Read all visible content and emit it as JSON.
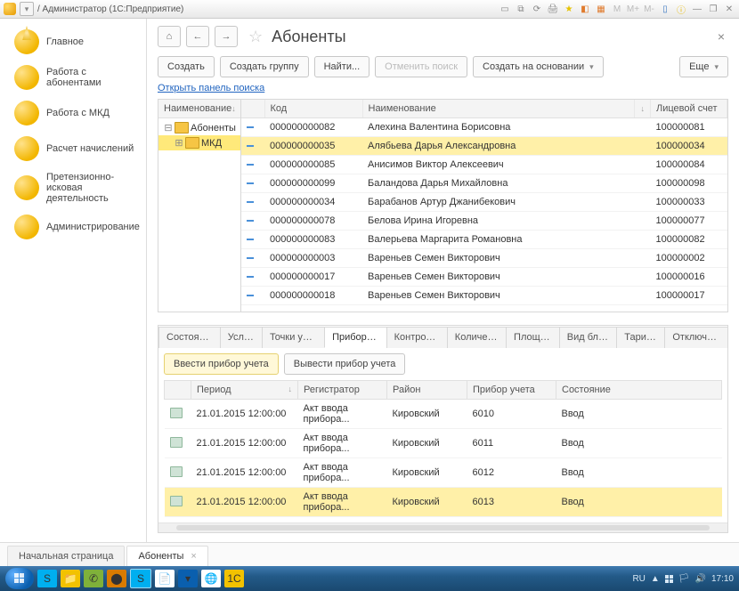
{
  "titlebar": {
    "text": "/ Администратор  (1С:Предприятие)"
  },
  "sidebar": {
    "items": [
      {
        "label": "Главное"
      },
      {
        "label": "Работа с абонентами"
      },
      {
        "label": "Работа с МКД"
      },
      {
        "label": "Расчет начислений"
      },
      {
        "label": "Претензионно-исковая деятельность"
      },
      {
        "label": "Администрирование"
      }
    ]
  },
  "page": {
    "title": "Абоненты"
  },
  "toolbar": {
    "create": "Создать",
    "create_group": "Создать группу",
    "find": "Найти...",
    "cancel_find": "Отменить поиск",
    "create_based": "Создать на основании",
    "more": "Еще"
  },
  "search_link": "Открыть панель поиска",
  "tree": {
    "header": "Наименование",
    "items": [
      {
        "label": "Абоненты",
        "selected": false,
        "expander": "⊟"
      },
      {
        "label": "МКД",
        "selected": true,
        "expander": "⊞"
      }
    ]
  },
  "grid": {
    "columns": {
      "code": "Код",
      "name": "Наименование",
      "account": "Лицевой счет"
    },
    "rows": [
      {
        "code": "000000000082",
        "name": "Алехина Валентина Борисовна",
        "account": "100000081"
      },
      {
        "code": "000000000035",
        "name": "Алябьева Дарья Александровна",
        "account": "100000034",
        "selected": true
      },
      {
        "code": "000000000085",
        "name": "Анисимов Виктор Алексеевич",
        "account": "100000084"
      },
      {
        "code": "000000000099",
        "name": "Баландова Дарья Михайловна",
        "account": "100000098"
      },
      {
        "code": "000000000034",
        "name": "Барабанов Артур Джанибекович",
        "account": "100000033"
      },
      {
        "code": "000000000078",
        "name": "Белова Ирина Игоревна",
        "account": "100000077"
      },
      {
        "code": "000000000083",
        "name": "Валерьева Маргарита Романовна",
        "account": "100000082"
      },
      {
        "code": "000000000003",
        "name": "Вареньев Семен Викторович",
        "account": "100000002"
      },
      {
        "code": "000000000017",
        "name": "Вареньев Семен Викторович",
        "account": "100000016"
      },
      {
        "code": "000000000018",
        "name": "Вареньев Семен Викторович",
        "account": "100000017"
      }
    ]
  },
  "tabs": [
    "Состояни...",
    "Услуги",
    "Точки учета",
    "Приборы ...",
    "Контроле...",
    "Количест...",
    "Площадь",
    "Вид благ...",
    "Тарифы",
    "Отключае..."
  ],
  "tabs_active_index": 3,
  "detail_toolbar": {
    "enter_meter": "Ввести прибор учета",
    "remove_meter": "Вывести прибор учета"
  },
  "detail_grid": {
    "columns": {
      "period": "Период",
      "registrar": "Регистратор",
      "district": "Район",
      "meter": "Прибор учета",
      "state": "Состояние"
    },
    "rows": [
      {
        "period": "21.01.2015 12:00:00",
        "registrar": "Акт ввода прибора...",
        "district": "Кировский",
        "meter": "6010",
        "state": "Ввод"
      },
      {
        "period": "21.01.2015 12:00:00",
        "registrar": "Акт ввода прибора...",
        "district": "Кировский",
        "meter": "6011",
        "state": "Ввод"
      },
      {
        "period": "21.01.2015 12:00:00",
        "registrar": "Акт ввода прибора...",
        "district": "Кировский",
        "meter": "6012",
        "state": "Ввод"
      },
      {
        "period": "21.01.2015 12:00:00",
        "registrar": "Акт ввода прибора...",
        "district": "Кировский",
        "meter": "6013",
        "state": "Ввод",
        "selected": true
      }
    ]
  },
  "bottom_tabs": [
    {
      "label": "Начальная страница",
      "active": false
    },
    {
      "label": "Абоненты",
      "active": true,
      "closable": true
    }
  ],
  "tray": {
    "lang": "RU",
    "time": "17:10"
  }
}
